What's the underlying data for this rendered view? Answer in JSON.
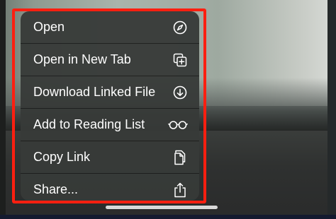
{
  "menu": {
    "items": [
      {
        "label": "Open",
        "icon": "compass-icon"
      },
      {
        "label": "Open in New Tab",
        "icon": "new-tab-icon"
      },
      {
        "label": "Download Linked File",
        "icon": "download-icon"
      },
      {
        "label": "Add to Reading List",
        "icon": "glasses-icon"
      },
      {
        "label": "Copy Link",
        "icon": "copy-icon"
      },
      {
        "label": "Share...",
        "icon": "share-icon"
      }
    ],
    "highlight_color": "#ff1f10"
  }
}
